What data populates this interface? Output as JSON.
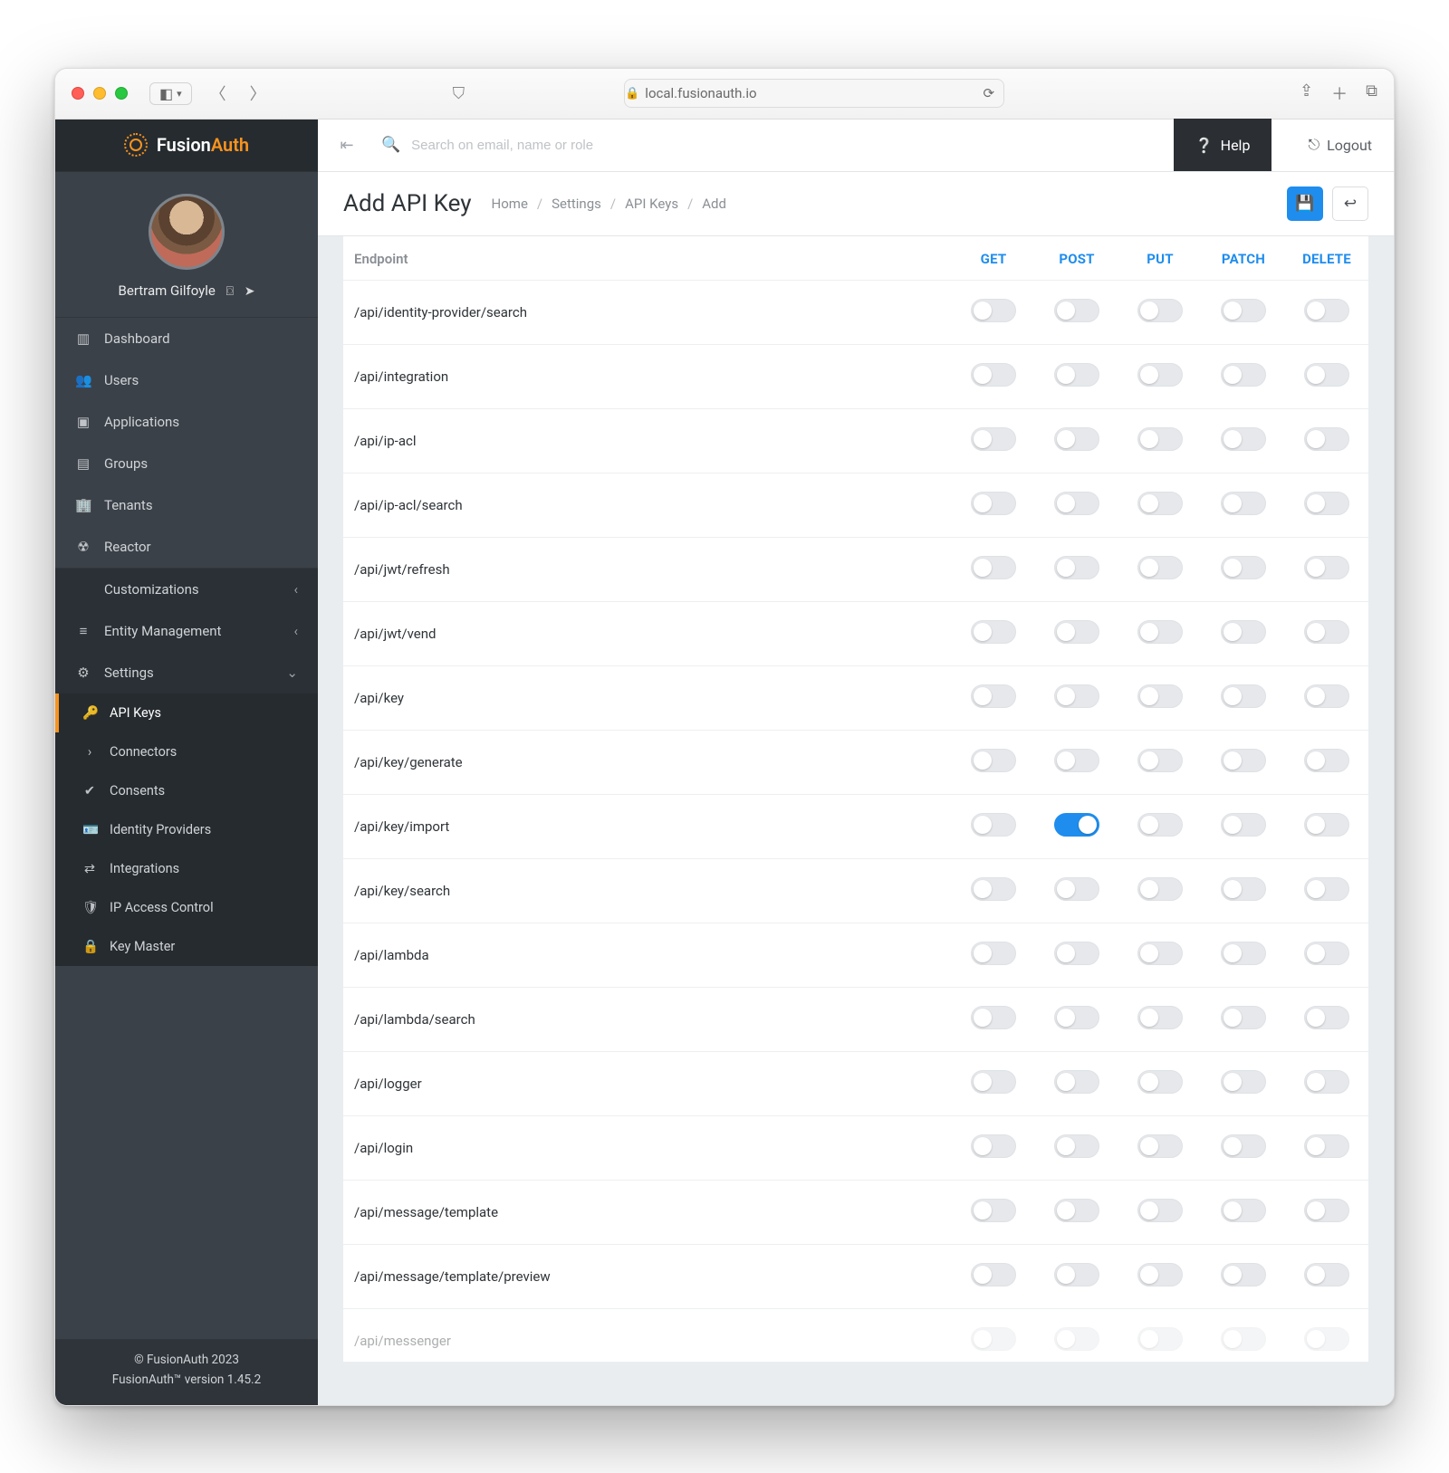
{
  "browser": {
    "url": "local.fusionauth.io"
  },
  "brand": {
    "name_a": "Fusion",
    "name_b": "Auth"
  },
  "user": {
    "name": "Bertram Gilfoyle"
  },
  "search": {
    "placeholder": "Search on email, name or role"
  },
  "topbar": {
    "help": "Help",
    "logout": "Logout"
  },
  "page": {
    "title": "Add API Key",
    "crumbs": [
      "Home",
      "Settings",
      "API Keys",
      "Add"
    ]
  },
  "sidebar": {
    "items": [
      {
        "label": "Dashboard",
        "icon": "▥"
      },
      {
        "label": "Users",
        "icon": "👥"
      },
      {
        "label": "Applications",
        "icon": "▣"
      },
      {
        "label": "Groups",
        "icon": "▤"
      },
      {
        "label": "Tenants",
        "icon": "🏢"
      },
      {
        "label": "Reactor",
        "icon": "☢"
      }
    ],
    "groups": [
      {
        "label": "Customizations",
        "icon": "</>",
        "state": "collapsed"
      },
      {
        "label": "Entity Management",
        "icon": "≡",
        "state": "collapsed"
      },
      {
        "label": "Settings",
        "icon": "⚙",
        "state": "expanded"
      }
    ],
    "settings_children": [
      {
        "label": "API Keys",
        "icon": "🔑",
        "active": true
      },
      {
        "label": "Connectors",
        "icon": "›"
      },
      {
        "label": "Consents",
        "icon": "✔"
      },
      {
        "label": "Identity Providers",
        "icon": "🪪"
      },
      {
        "label": "Integrations",
        "icon": "⇄"
      },
      {
        "label": "IP Access Control",
        "icon": "🛡"
      },
      {
        "label": "Key Master",
        "icon": "🔒"
      }
    ],
    "footer": {
      "line1": "© FusionAuth 2023",
      "line2": "FusionAuth™ version 1.45.2"
    }
  },
  "table": {
    "head_endpoint": "Endpoint",
    "methods": [
      "GET",
      "POST",
      "PUT",
      "PATCH",
      "DELETE"
    ],
    "rows": [
      {
        "ep": "/api/identity-provider/search",
        "on": []
      },
      {
        "ep": "/api/integration",
        "on": []
      },
      {
        "ep": "/api/ip-acl",
        "on": []
      },
      {
        "ep": "/api/ip-acl/search",
        "on": []
      },
      {
        "ep": "/api/jwt/refresh",
        "on": []
      },
      {
        "ep": "/api/jwt/vend",
        "on": []
      },
      {
        "ep": "/api/key",
        "on": []
      },
      {
        "ep": "/api/key/generate",
        "on": []
      },
      {
        "ep": "/api/key/import",
        "on": [
          "POST"
        ]
      },
      {
        "ep": "/api/key/search",
        "on": []
      },
      {
        "ep": "/api/lambda",
        "on": []
      },
      {
        "ep": "/api/lambda/search",
        "on": []
      },
      {
        "ep": "/api/logger",
        "on": []
      },
      {
        "ep": "/api/login",
        "on": []
      },
      {
        "ep": "/api/message/template",
        "on": []
      },
      {
        "ep": "/api/message/template/preview",
        "on": []
      },
      {
        "ep": "/api/messenger",
        "on": []
      }
    ]
  }
}
